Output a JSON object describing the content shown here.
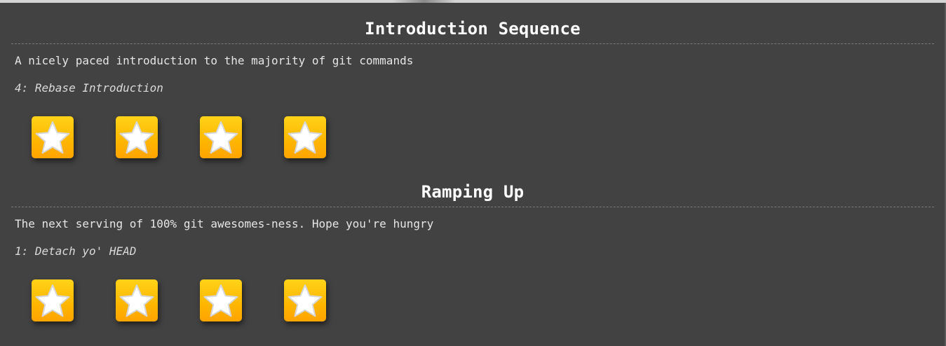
{
  "sequences": [
    {
      "title": "Introduction Sequence",
      "about": "A nicely paced introduction to the majority of git commands",
      "level_label": "4: Rebase Introduction",
      "levels_solved": 4,
      "levels_total": 4
    },
    {
      "title": "Ramping Up",
      "about": "The next serving of 100% git awesomes-ness. Hope you're hungry",
      "level_label": "1: Detach yo' HEAD",
      "levels_solved": 4,
      "levels_total": 4
    }
  ],
  "colors": {
    "background": "#424242",
    "star_tile_top": "#ffd21a",
    "star_tile_bottom": "#ffa400",
    "star_fill": "#ffffff"
  },
  "icons": {
    "level_tile": "star-icon"
  }
}
